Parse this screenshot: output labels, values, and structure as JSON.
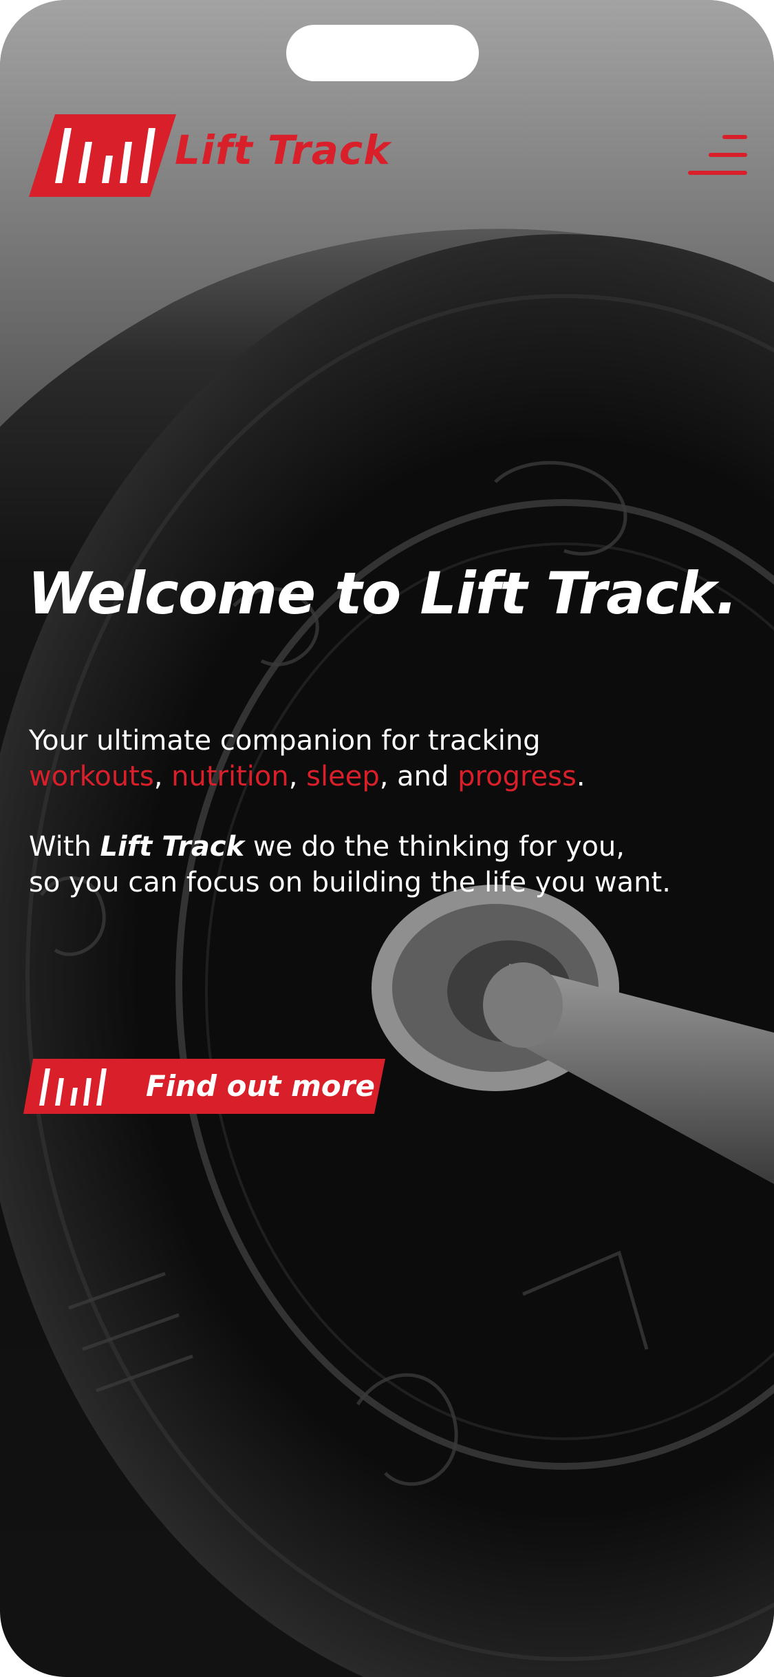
{
  "brand": {
    "name": "Lift Track",
    "accent_color": "#d9202a",
    "logo_icon": "bar-chart-icon"
  },
  "nav": {
    "menu_icon": "hamburger-menu-icon"
  },
  "hero": {
    "title": "Welcome to Lift Track.",
    "line1": "Your ultimate companion for tracking",
    "highlight1": "workouts",
    "sep1": ", ",
    "highlight2": "nutrition",
    "sep2": ", ",
    "highlight3": "sleep",
    "sep3": ", and ",
    "highlight4": "progress",
    "end1": ".",
    "line3_pre": "With ",
    "line3_brand": "Lift Track",
    "line3_post": " we do the thinking for you,",
    "line4": "so you can focus on building the life you want."
  },
  "cta": {
    "label": "Find out more",
    "icon": "bar-chart-icon"
  }
}
